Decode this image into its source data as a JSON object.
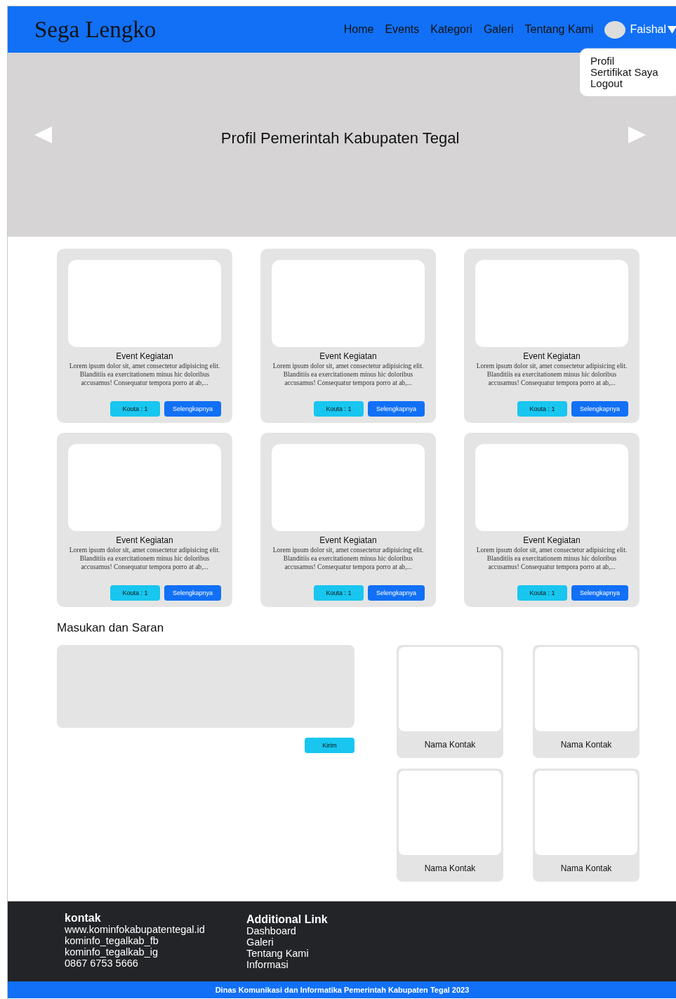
{
  "header": {
    "logo": "Sega Lengko",
    "nav": [
      "Home",
      "Events",
      "Kategori",
      "Galeri",
      "Tentang Kami"
    ],
    "user": "Faishal",
    "dropdown": [
      "Profil",
      "Sertifikat Saya",
      "Logout"
    ]
  },
  "hero": {
    "title": "Profil Pemerintah Kabupaten Tegal"
  },
  "events": [
    {
      "title": "Event Kegiatan",
      "description": "Lorem ipsum dolor sit, amet consectetur adipisicing elit. Blanditiis ea exercitationem minus hic doloribus accusamus! Consequatur tempora porro at ab,...",
      "quota": "Kouta : 1",
      "button": "Selengkapnya"
    },
    {
      "title": "Event Kegiatan",
      "description": "Lorem ipsum dolor sit, amet consectetur adipisicing elit. Blanditiis ea exercitationem minus hic doloribus accusamus! Consequatur tempora porro at ab,...",
      "quota": "Kouta : 1",
      "button": "Selengkapnya"
    },
    {
      "title": "Event Kegiatan",
      "description": "Lorem ipsum dolor sit, amet consectetur adipisicing elit. Blanditiis ea exercitationem minus hic doloribus accusamus! Consequatur tempora porro at ab,...",
      "quota": "Kouta : 1",
      "button": "Selengkapnya"
    },
    {
      "title": "Event Kegiatan",
      "description": "Lorem ipsum dolor sit, amet consectetur adipisicing elit. Blanditiis ea exercitationem minus hic doloribus accusamus! Consequatur tempora porro at ab,...",
      "quota": "Kouta : 1",
      "button": "Selengkapnya"
    },
    {
      "title": "Event Kegiatan",
      "description": "Lorem ipsum dolor sit, amet consectetur adipisicing elit. Blanditiis ea exercitationem minus hic doloribus accusamus! Consequatur tempora porro at ab,...",
      "quota": "Kouta : 1",
      "button": "Selengkapnya"
    },
    {
      "title": "Event Kegiatan",
      "description": "Lorem ipsum dolor sit, amet consectetur adipisicing elit. Blanditiis ea exercitationem minus hic doloribus accusamus! Consequatur tempora porro at ab,...",
      "quota": "Kouta : 1",
      "button": "Selengkapnya"
    }
  ],
  "feedback": {
    "heading": "Masukan dan Saran",
    "submit": "Kirim"
  },
  "contacts": [
    "Nama Kontak",
    "Nama Kontak",
    "Nama Kontak",
    "Nama Kontak"
  ],
  "footer": {
    "contact_heading": "kontak",
    "contact_lines": [
      "www.kominfokabupatentegal.id",
      "kominfo_tegalkab_fb",
      "kominfo_tegalkab_ig",
      "0867 6753 5666"
    ],
    "links_heading": "Additional Link",
    "links": [
      "Dashboard",
      "Galeri",
      "Tentang Kami",
      "Informasi"
    ],
    "copyright": "Dinas Komunikasi dan Informatika Pemerintah Kabupaten Tegal 2023"
  }
}
